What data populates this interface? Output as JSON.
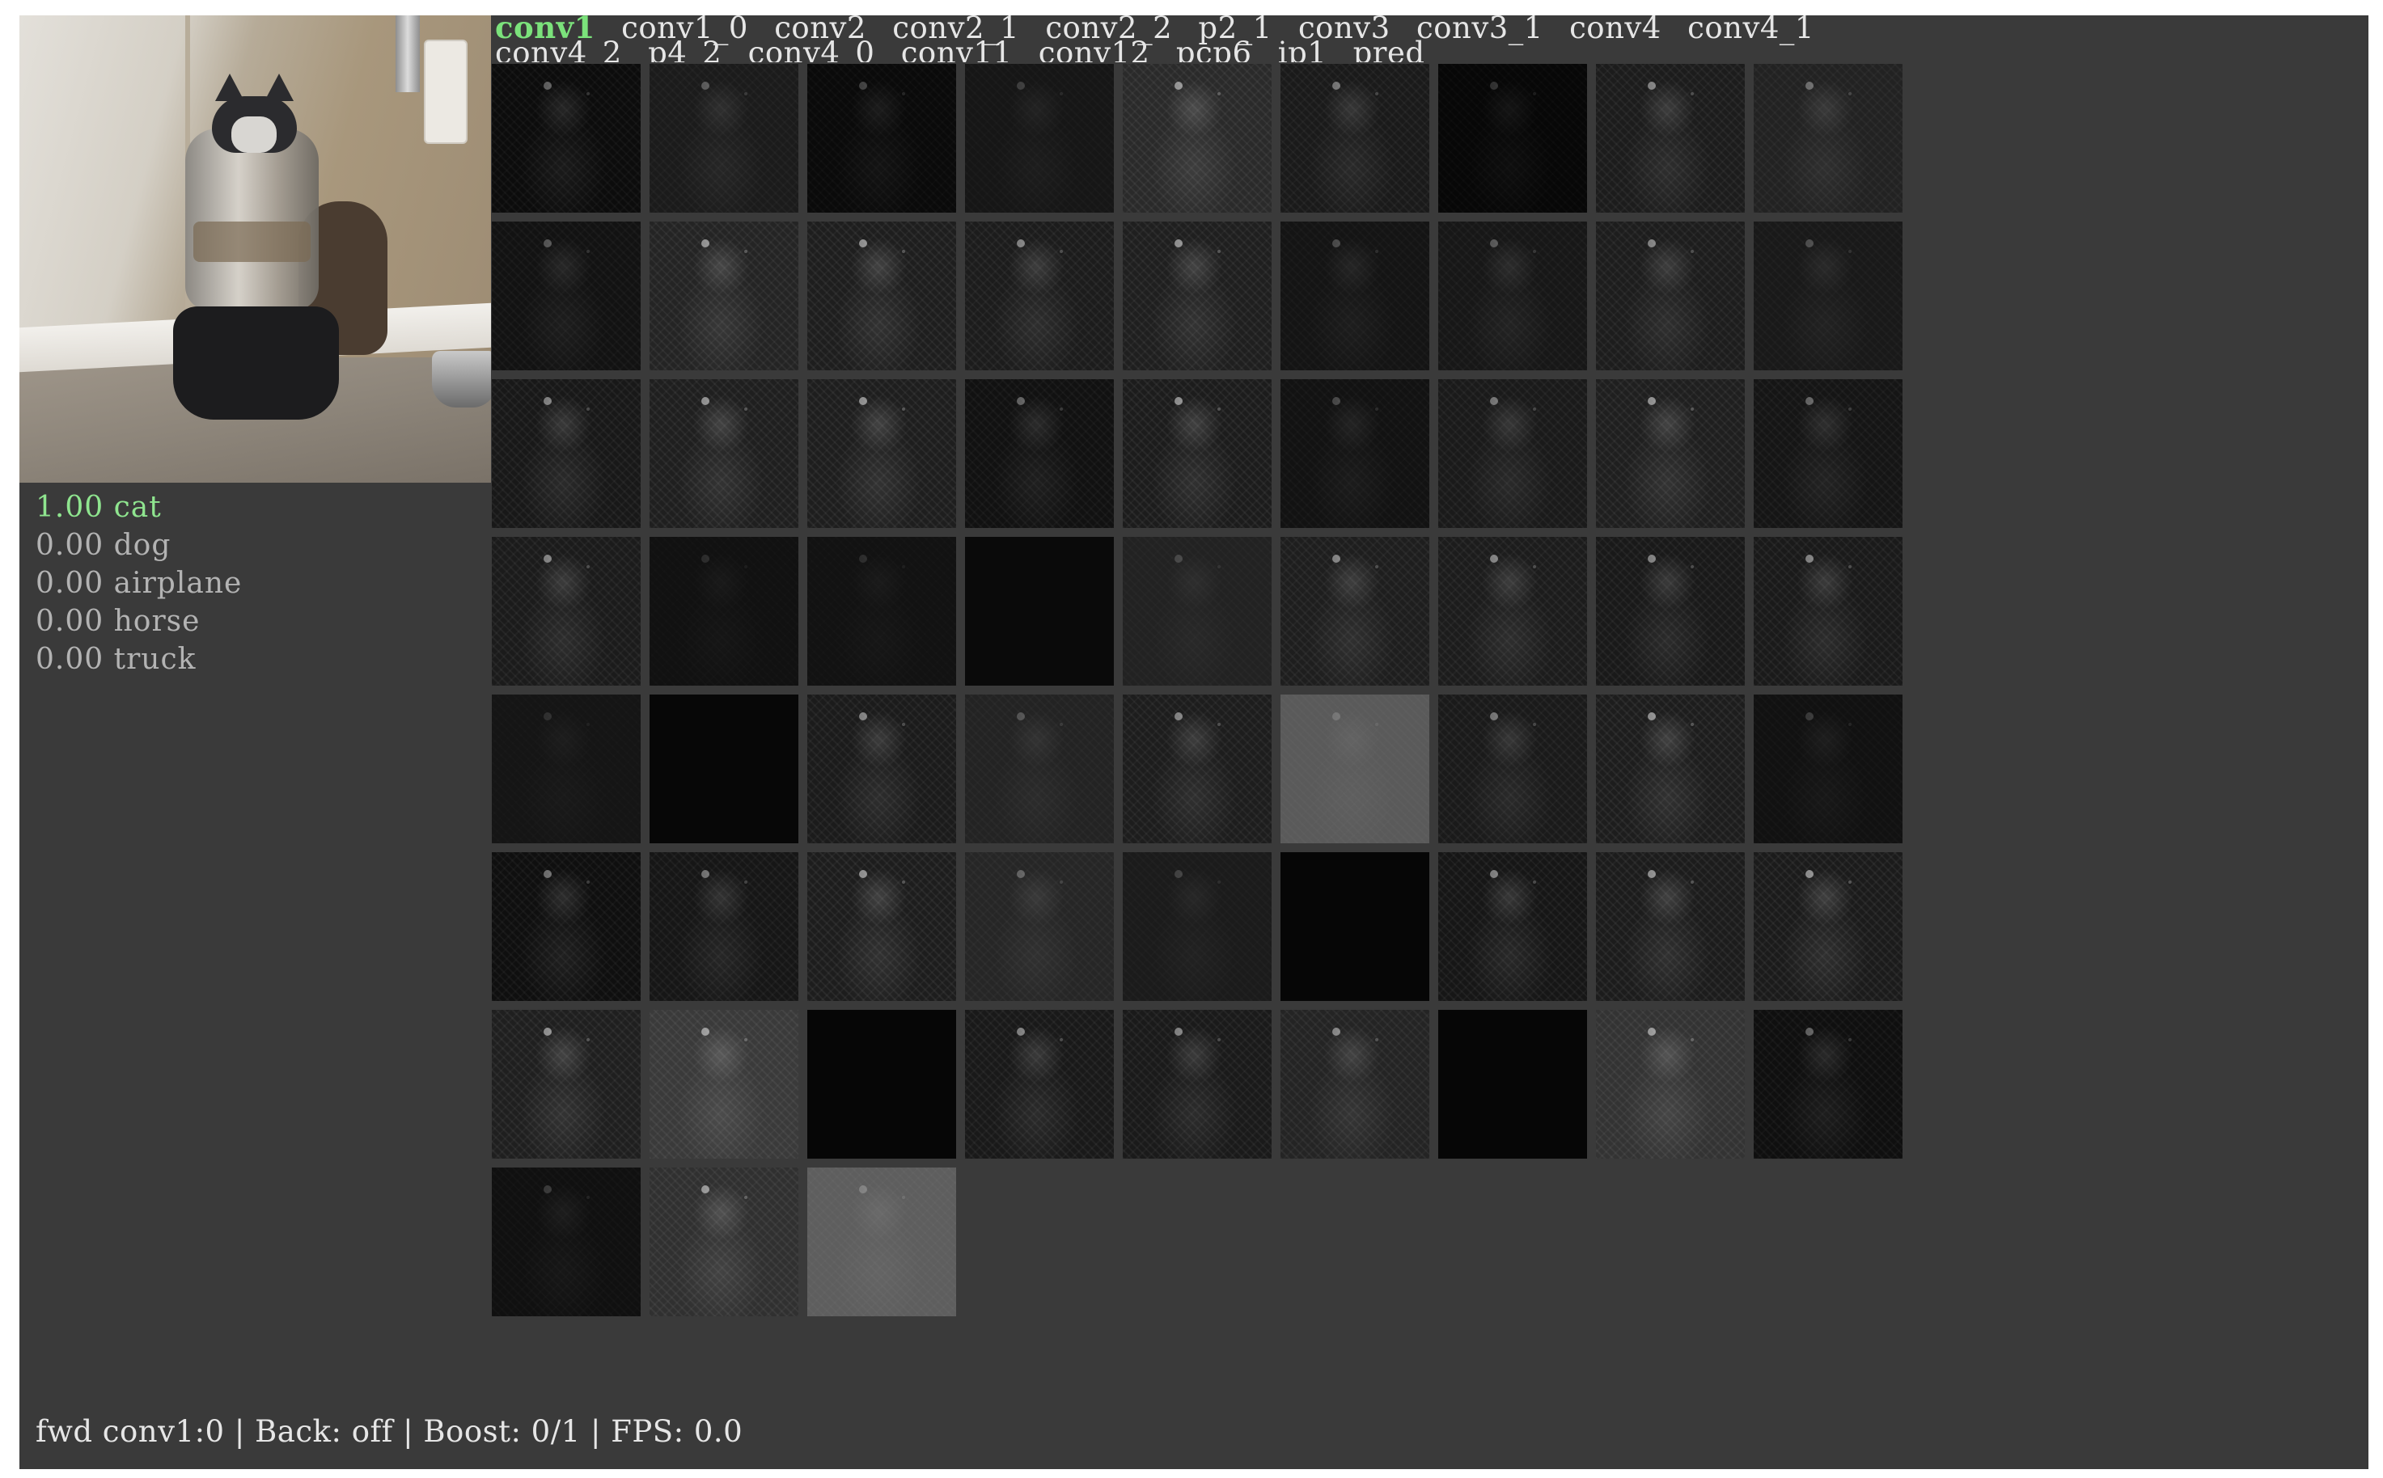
{
  "app": {
    "background_color": "#3a3a3a"
  },
  "preview": {
    "subject": "cat behind water dispenser",
    "icon": "camera-frame"
  },
  "predictions": [
    {
      "score": "1.00",
      "label": "cat",
      "top": true
    },
    {
      "score": "0.00",
      "label": "dog",
      "top": false
    },
    {
      "score": "0.00",
      "label": "airplane",
      "top": false
    },
    {
      "score": "0.00",
      "label": "horse",
      "top": false
    },
    {
      "score": "0.00",
      "label": "truck",
      "top": false
    }
  ],
  "layers": [
    {
      "label": "conv1",
      "active": true
    },
    {
      "label": "conv1_0",
      "active": false
    },
    {
      "label": "conv2",
      "active": false
    },
    {
      "label": "conv2_1",
      "active": false
    },
    {
      "label": "conv2_2",
      "active": false
    },
    {
      "label": "p2_1",
      "active": false
    },
    {
      "label": "conv3",
      "active": false
    },
    {
      "label": "conv3_1",
      "active": false
    },
    {
      "label": "conv4",
      "active": false
    },
    {
      "label": "conv4_1",
      "active": false
    },
    {
      "label": "conv4_2",
      "active": false
    },
    {
      "label": "p4_2",
      "active": false
    },
    {
      "label": "conv4_0",
      "active": false
    },
    {
      "label": "conv11",
      "active": false
    },
    {
      "label": "conv12",
      "active": false
    },
    {
      "label": "pcp6",
      "active": false
    },
    {
      "label": "ip1",
      "active": false
    },
    {
      "label": "pred",
      "active": false
    }
  ],
  "feature_maps": {
    "count": 66,
    "brightness": [
      "#0c0c0c",
      "#1b1b1b",
      "#0a0a0a",
      "#161616",
      "#2a2a2a",
      "#1a1a1a",
      "#070707",
      "#1c1c1c",
      "#222222",
      "#121212",
      "#242424",
      "#1e1e1e",
      "#1c1c1c",
      "#1f1f1f",
      "#141414",
      "#171717",
      "#1d1d1d",
      "#191919",
      "#181818",
      "#1f1f1f",
      "#1e1e1e",
      "#111111",
      "#1c1c1c",
      "#121212",
      "#1a1a1a",
      "#1f1f1f",
      "#151515",
      "#1b1b1b",
      "#111111",
      "#121212",
      "#0a0a0a",
      "#222222",
      "#1e1e1e",
      "#1c1c1c",
      "#191919",
      "#1a1a1a",
      "#151515",
      "#070707",
      "#1b1b1b",
      "#232323",
      "#1d1d1d",
      "#5a5a5a",
      "#1a1a1a",
      "#1d1d1d",
      "#111111",
      "#0f0f0f",
      "#161616",
      "#1d1d1d",
      "#262626",
      "#1b1b1b",
      "#060606",
      "#161616",
      "#1c1c1c",
      "#1b1b1b",
      "#1f1f1f",
      "#3a3a3a",
      "#060606",
      "#191919",
      "#1a1a1a",
      "#242424",
      "#060606",
      "#333333",
      "#0f0f0f",
      "#101010",
      "#303030",
      "#5e5e5e"
    ],
    "texture": [
      0.6,
      0.5,
      0.4,
      0.3,
      0.9,
      0.7,
      0.3,
      0.8,
      0.6,
      0.5,
      0.9,
      0.9,
      0.8,
      0.9,
      0.4,
      0.5,
      0.8,
      0.4,
      0.8,
      0.9,
      0.9,
      0.6,
      0.9,
      0.4,
      0.7,
      0.9,
      0.6,
      0.8,
      0.2,
      0.2,
      0,
      0.3,
      0.8,
      0.8,
      0.8,
      0.8,
      0.2,
      0,
      0.8,
      0.4,
      0.8,
      0.3,
      0.7,
      0.9,
      0.3,
      0.7,
      0.7,
      0.9,
      0.5,
      0.3,
      0,
      0.8,
      0.9,
      0.9,
      0.9,
      0.9,
      0,
      0.8,
      0.8,
      0.8,
      0,
      0.9,
      0.6,
      0.3,
      0.9,
      0.4
    ]
  },
  "status": {
    "text": "fwd conv1:0 | Back: off | Boost: 0/1 | FPS: 0.0"
  }
}
